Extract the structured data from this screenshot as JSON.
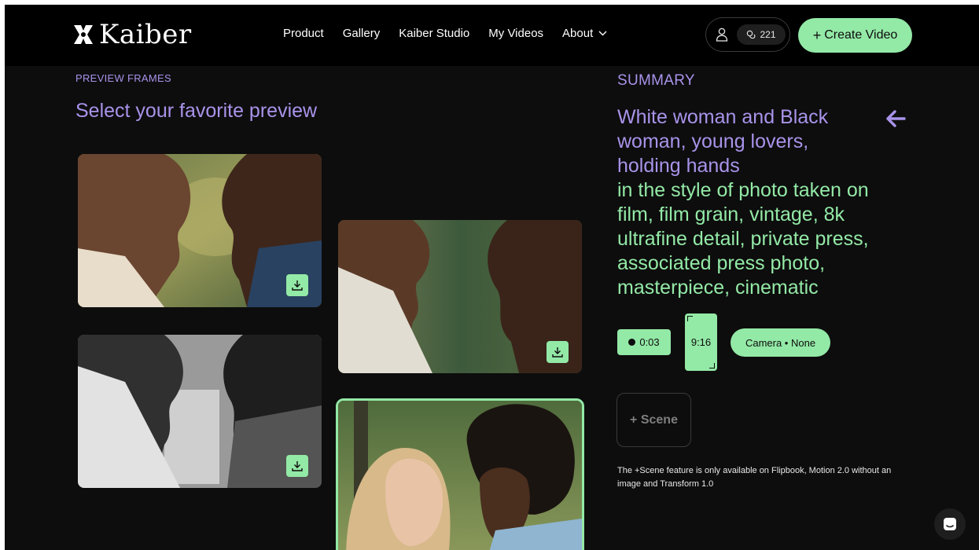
{
  "brand": {
    "name": "Kaiber",
    "logo_icon": "kaiber-x-logo-icon"
  },
  "nav": {
    "items": [
      {
        "label": "Product"
      },
      {
        "label": "Gallery"
      },
      {
        "label": "Kaiber Studio"
      },
      {
        "label": "My Videos"
      },
      {
        "label": "About"
      }
    ]
  },
  "account": {
    "credits": "221"
  },
  "header": {
    "create_label": "Create Video"
  },
  "preview": {
    "eyebrow": "PREVIEW FRAMES",
    "title": "Select your favorite preview"
  },
  "summary": {
    "eyebrow": "SUMMARY",
    "subject_prompt": "White woman and Black woman, young lovers, holding hands",
    "style_prompt": "in the style of photo taken on film, film grain, vintage, 8k ultrafine detail, private press, associated press photo, masterpiece, cinematic",
    "duration": "0:03",
    "aspect_ratio": "9:16",
    "camera": "Camera • None",
    "scene_button": "+ Scene",
    "scene_note": "The +Scene feature is only available on Flipbook, Motion 2.0 without an image and Transform 1.0"
  },
  "colors": {
    "accent_green": "#93e9a6",
    "accent_purple": "#a993ea",
    "background": "#0d0d0d",
    "header_background": "#000000"
  }
}
